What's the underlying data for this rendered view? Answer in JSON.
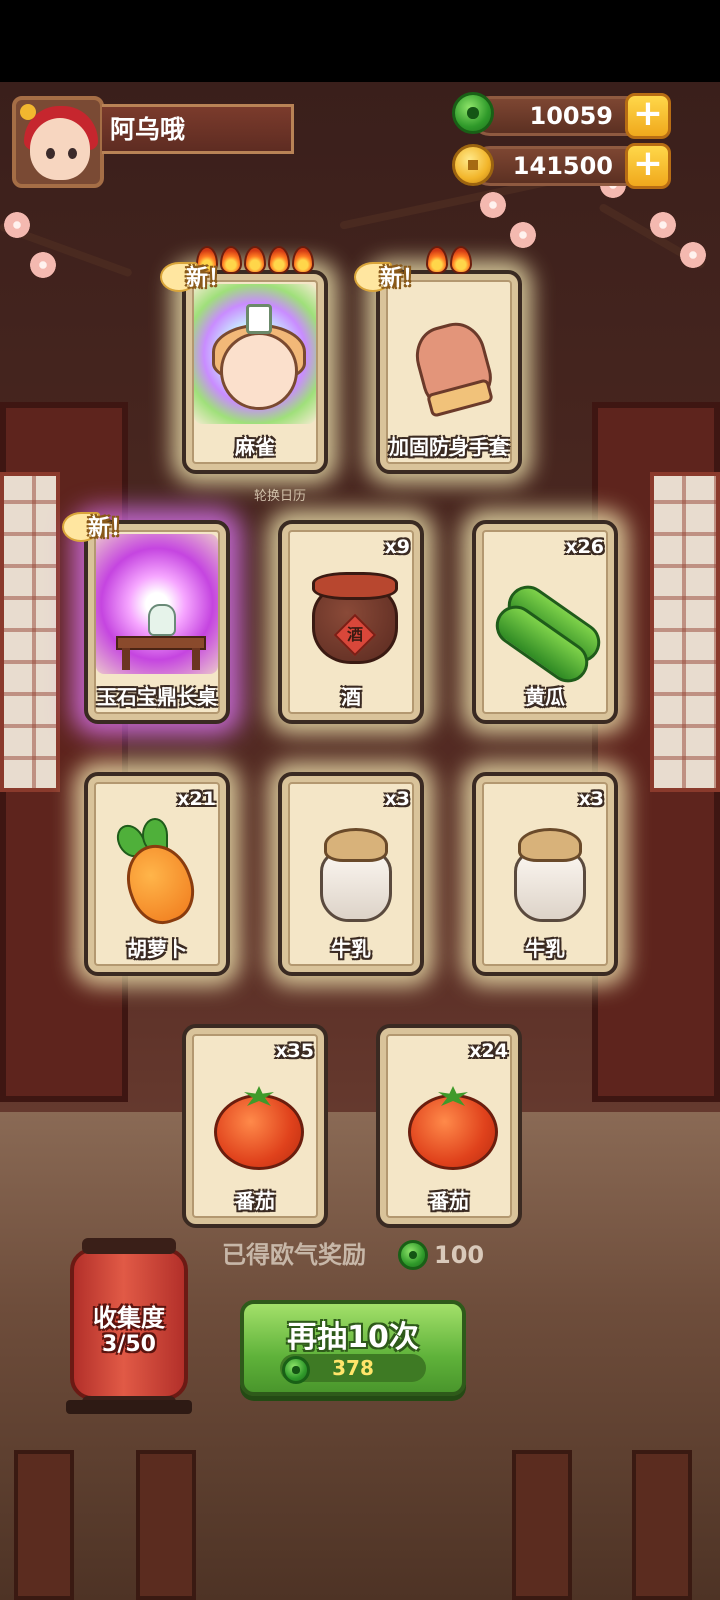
{
  "player": {
    "name": "阿乌哦"
  },
  "resources": {
    "jade": "10059",
    "gold": "141500",
    "jade_plus": "+",
    "gold_plus": "+"
  },
  "cards": [
    {
      "label": "麻雀",
      "qty": "",
      "is_new": true,
      "new_text": "新！",
      "flames": 5,
      "art": "character"
    },
    {
      "label": "加固防身手套",
      "qty": "",
      "is_new": true,
      "new_text": "新！",
      "flames": 2,
      "art": "glove"
    },
    {
      "label": "玉石宝鼎长桌",
      "qty": "",
      "is_new": true,
      "new_text": "新！",
      "flames": 0,
      "art": "table"
    },
    {
      "label": "酒",
      "qty": "x9",
      "is_new": false,
      "art": "wine-jar",
      "jar_char": "酒"
    },
    {
      "label": "黄瓜",
      "qty": "x26",
      "is_new": false,
      "art": "cucumber"
    },
    {
      "label": "胡萝卜",
      "qty": "x21",
      "is_new": false,
      "art": "carrot"
    },
    {
      "label": "牛乳",
      "qty": "x3",
      "is_new": false,
      "art": "milk"
    },
    {
      "label": "牛乳",
      "qty": "x3",
      "is_new": false,
      "art": "milk"
    },
    {
      "label": "番茄",
      "qty": "x35",
      "is_new": false,
      "art": "tomato"
    },
    {
      "label": "番茄",
      "qty": "x24",
      "is_new": false,
      "art": "tomato"
    }
  ],
  "background_label": "轮换日历",
  "reward": {
    "text": "已得欧气奖励",
    "value": "100"
  },
  "collection": {
    "title": "收集度",
    "progress": "3/50"
  },
  "draw_button": {
    "label": "再抽10次",
    "cost": "378"
  },
  "colors": {
    "jade": "#2f9a2a",
    "gold": "#f2b52a",
    "draw_button": "#5fb23a",
    "lantern": "#e15a46"
  }
}
